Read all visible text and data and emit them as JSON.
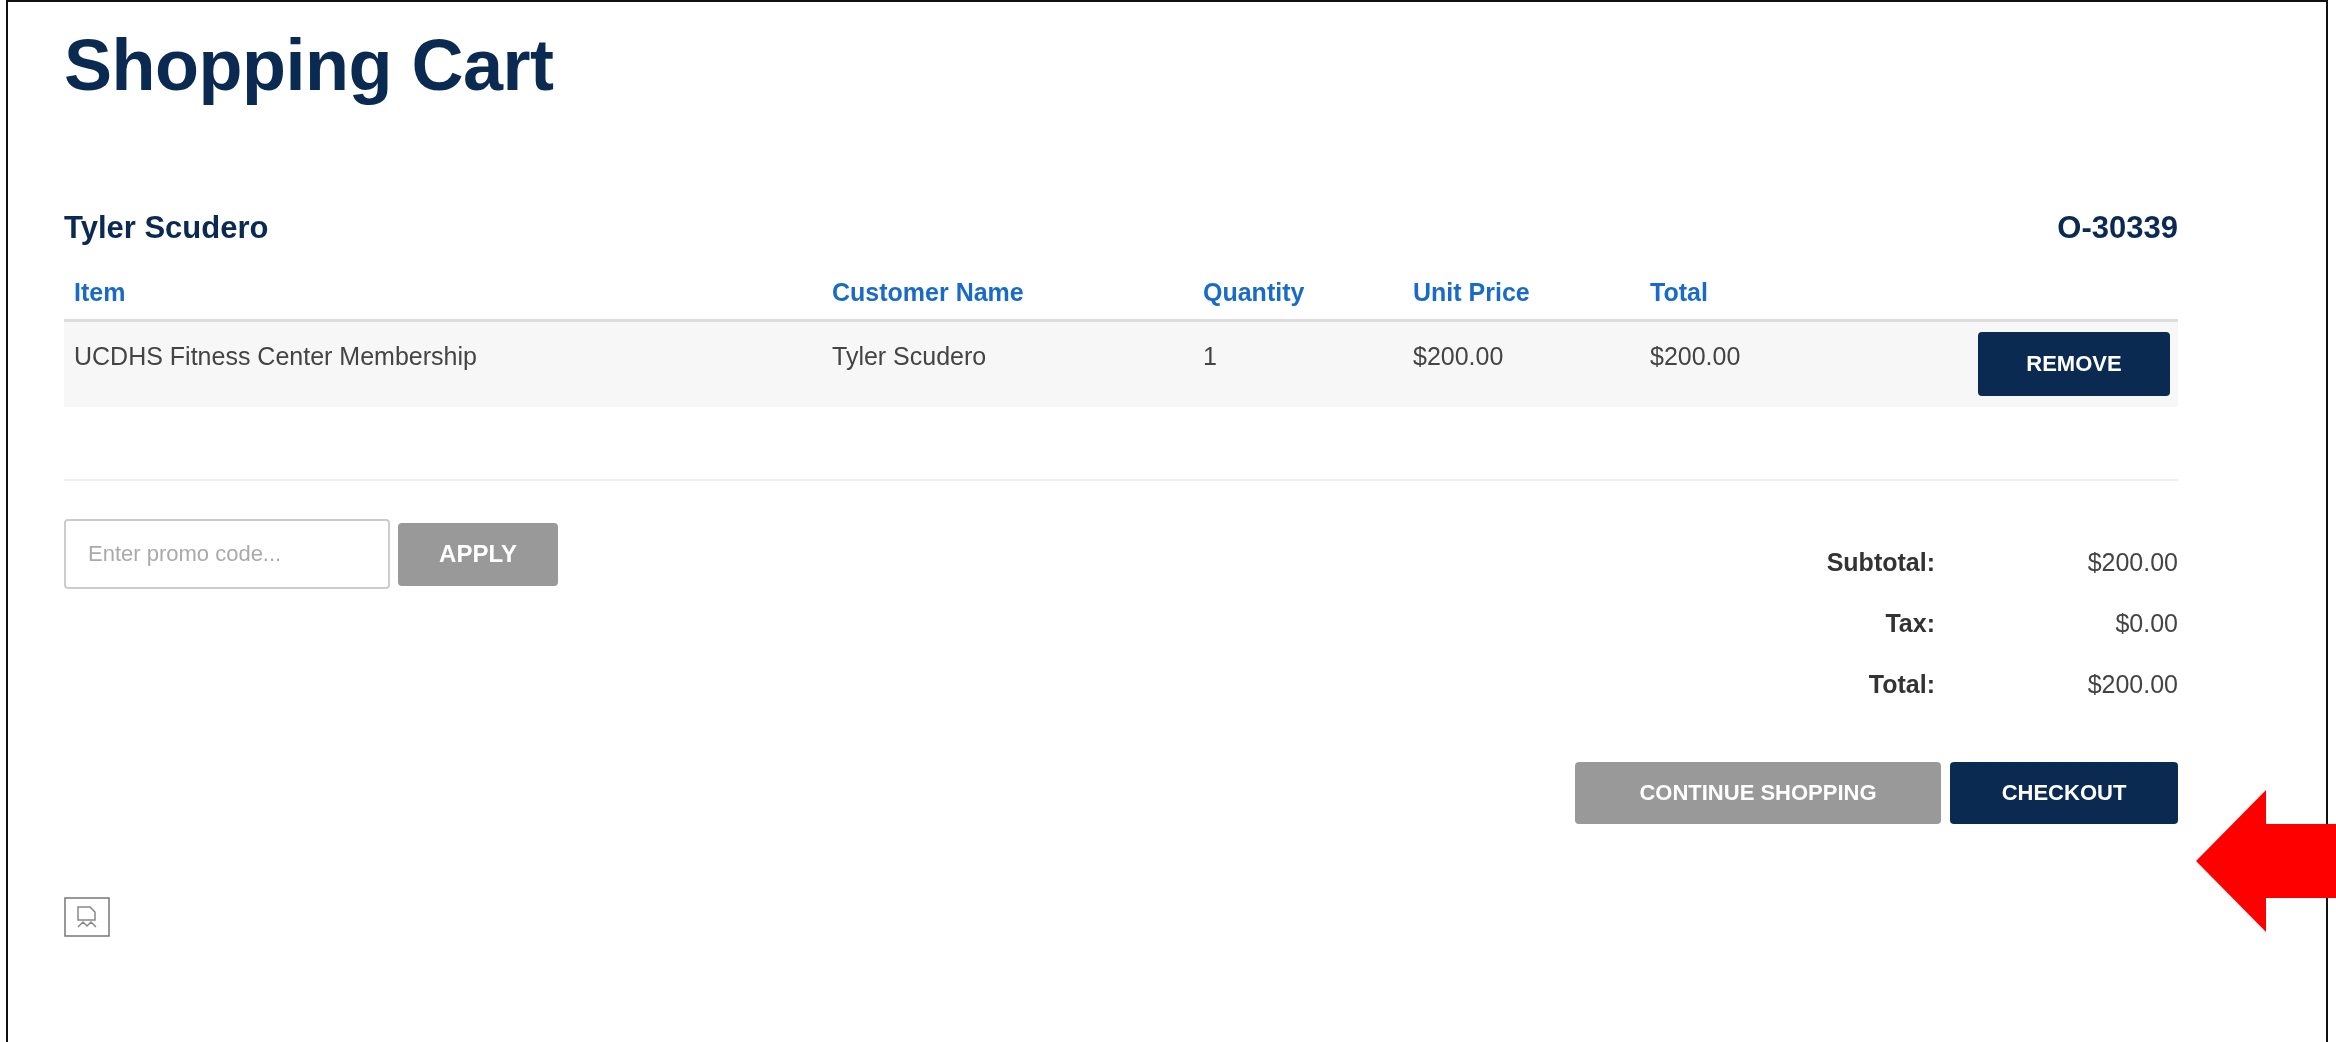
{
  "title": "Shopping Cart",
  "customer_name": "Tyler Scudero",
  "order_number": "O-30339",
  "table": {
    "columns": [
      "Item",
      "Customer Name",
      "Quantity",
      "Unit Price",
      "Total"
    ],
    "rows": [
      {
        "cells": [
          "UCDHS Fitness Center Membership",
          "Tyler Scudero",
          "1",
          "$200.00",
          "$200.00"
        ],
        "action": "REMOVE"
      }
    ]
  },
  "promo": {
    "placeholder": "Enter promo code...",
    "button": "APPLY"
  },
  "summary": [
    {
      "label": "Subtotal:",
      "value": "$200.00"
    },
    {
      "label": "Tax:",
      "value": "$0.00"
    },
    {
      "label": "Total:",
      "value": "$200.00"
    }
  ],
  "buttons": [
    {
      "label": "CONTINUE SHOPPING",
      "kind": "secondary"
    },
    {
      "label": "CHECKOUT",
      "kind": "primary"
    }
  ]
}
